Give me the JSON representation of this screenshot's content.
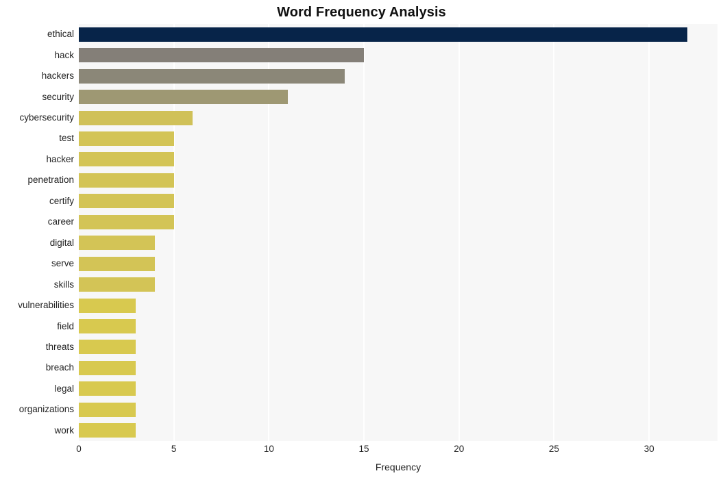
{
  "chart_data": {
    "type": "bar",
    "orientation": "horizontal",
    "title": "Word Frequency Analysis",
    "xlabel": "Frequency",
    "ylabel": "",
    "categories": [
      "ethical",
      "hack",
      "hackers",
      "security",
      "cybersecurity",
      "test",
      "hacker",
      "penetration",
      "certify",
      "career",
      "digital",
      "serve",
      "skills",
      "vulnerabilities",
      "field",
      "threats",
      "breach",
      "legal",
      "organizations",
      "work"
    ],
    "values": [
      32,
      15,
      14,
      11,
      6,
      5,
      5,
      5,
      5,
      5,
      4,
      4,
      4,
      3,
      3,
      3,
      3,
      3,
      3,
      3
    ],
    "bar_colors": [
      "#072449",
      "#847f78",
      "#8b8778",
      "#9e9873",
      "#d0c158",
      "#d3c456",
      "#d3c456",
      "#d3c456",
      "#d3c456",
      "#d3c456",
      "#d3c456",
      "#d3c456",
      "#d3c456",
      "#d8c94f",
      "#d8c94f",
      "#d8c94f",
      "#d8c94f",
      "#d8c94f",
      "#d8c94f",
      "#d8c94f"
    ],
    "xlim": [
      0,
      33.6
    ],
    "xticks": [
      0,
      5,
      10,
      15,
      20,
      25,
      30
    ],
    "xtick_labels": [
      "0",
      "5",
      "10",
      "15",
      "20",
      "25",
      "30"
    ],
    "grid": "vertical-only",
    "legend": "none",
    "plot_background": "#f7f7f7",
    "figure_background": "#ffffff",
    "gridline_color": "#ffffff"
  }
}
